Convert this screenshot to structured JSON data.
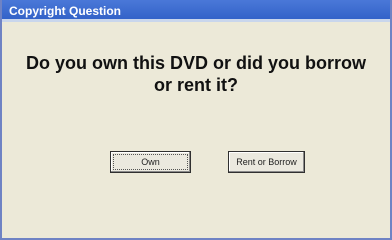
{
  "window": {
    "title": "Copyright Question"
  },
  "dialog": {
    "question": "Do you own this DVD or did you borrow or rent it?"
  },
  "buttons": {
    "own_label": "Own",
    "rent_label": "Rent or Borrow"
  },
  "colors": {
    "titlebar": "#2f5fc6",
    "dialog_background": "#ece9d8",
    "border": "#6f83c4"
  }
}
